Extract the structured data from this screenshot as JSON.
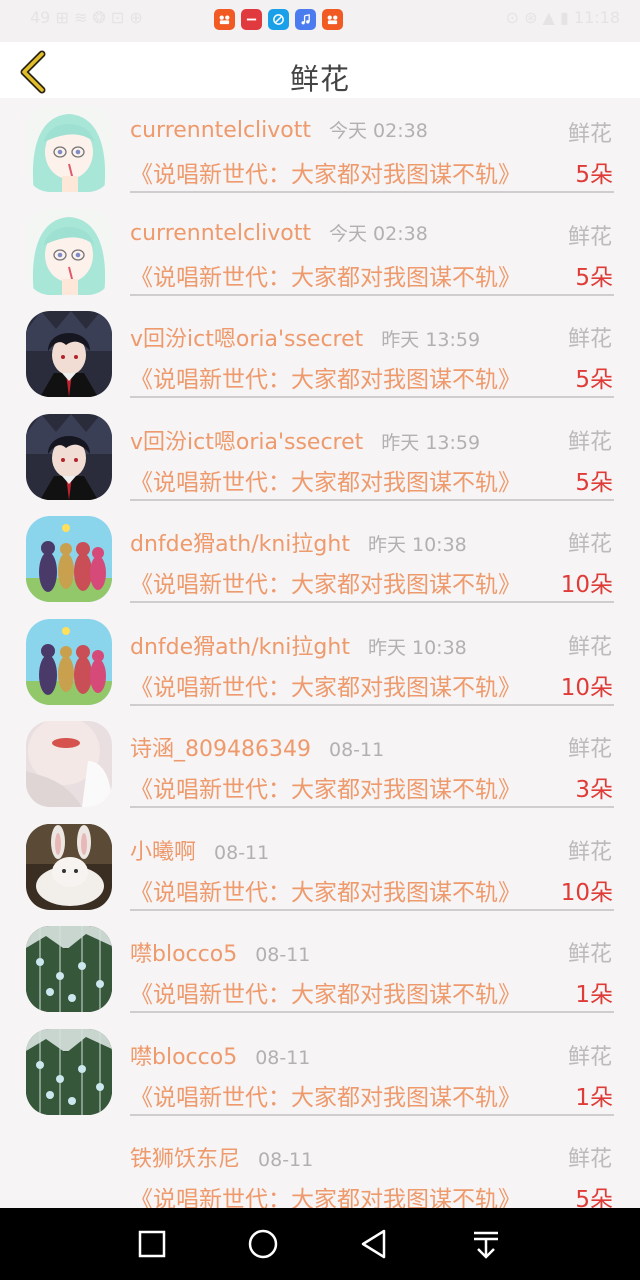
{
  "status_bar": {
    "left_text": "49  ⊞  ≋  ❂  ⊡  ⊕",
    "right_text": "⊙  ⊛  ▲  ▮  11:18",
    "app_icons": [
      {
        "icon": "app-icon-1",
        "color": "#f15a22"
      },
      {
        "icon": "app-icon-2",
        "color": "#e0393e"
      },
      {
        "icon": "app-icon-3",
        "color": "#1aa0e8"
      },
      {
        "icon": "music-icon",
        "color": "#4a7cf0"
      },
      {
        "icon": "app-icon-5",
        "color": "#f15a22"
      }
    ]
  },
  "header": {
    "title": "鲜花",
    "back_icon": "back-chevron-icon",
    "accent": "#e2bf2a"
  },
  "colors": {
    "name": "#ee9a6c",
    "amount": "#df3b37",
    "muted": "#b3b0b1"
  },
  "items": [
    {
      "name": "currenntelclivott",
      "time": "今天 02:38",
      "type": "鲜花",
      "song": "《说唱新世代：大家都对我图谋不轨》",
      "amount": "5朵",
      "avatar": "anime-girl-mint"
    },
    {
      "name": "currenntelclivott",
      "time": "今天 02:38",
      "type": "鲜花",
      "song": "《说唱新世代：大家都对我图谋不轨》",
      "amount": "5朵",
      "avatar": "anime-girl-mint"
    },
    {
      "name": "v回汾ict嗯oria'ssecret",
      "time": "昨天 13:59",
      "type": "鲜花",
      "song": "《说唱新世代：大家都对我图谋不轨》",
      "amount": "5朵",
      "avatar": "anime-boy-dark"
    },
    {
      "name": "v回汾ict嗯oria'ssecret",
      "time": "昨天 13:59",
      "type": "鲜花",
      "song": "《说唱新世代：大家都对我图谋不轨》",
      "amount": "5朵",
      "avatar": "anime-boy-dark"
    },
    {
      "name": "dnfde猾ath/kni拉ght",
      "time": "昨天 10:38",
      "type": "鲜花",
      "song": "《说唱新世代：大家都对我图谋不轨》",
      "amount": "10朵",
      "avatar": "teletubbies"
    },
    {
      "name": "dnfde猾ath/kni拉ght",
      "time": "昨天 10:38",
      "type": "鲜花",
      "song": "《说唱新世代：大家都对我图谋不轨》",
      "amount": "10朵",
      "avatar": "teletubbies"
    },
    {
      "name": "诗涵_809486349",
      "time": "08-11",
      "type": "鲜花",
      "song": "《说唱新世代：大家都对我图谋不轨》",
      "amount": "3朵",
      "avatar": "girl-lips"
    },
    {
      "name": "小曦啊",
      "time": "08-11",
      "type": "鲜花",
      "song": "《说唱新世代：大家都对我图谋不轨》",
      "amount": "10朵",
      "avatar": "bunny-cat"
    },
    {
      "name": "噤blocco5",
      "time": "08-11",
      "type": "鲜花",
      "song": "《说唱新世代：大家都对我图谋不轨》",
      "amount": "1朵",
      "avatar": "wind-chimes"
    },
    {
      "name": "噤blocco5",
      "time": "08-11",
      "type": "鲜花",
      "song": "《说唱新世代：大家都对我图谋不轨》",
      "amount": "1朵",
      "avatar": "wind-chimes"
    },
    {
      "name": "铁狮饫东尼",
      "time": "08-11",
      "type": "鲜花",
      "song": "《说唱新世代：大家都对我图谋不轨》",
      "amount": "5朵",
      "avatar": "none"
    }
  ],
  "nav_bar": {
    "buttons": [
      "recent-apps-icon",
      "home-icon",
      "back-triangle-icon",
      "notification-pull-down-icon"
    ]
  }
}
